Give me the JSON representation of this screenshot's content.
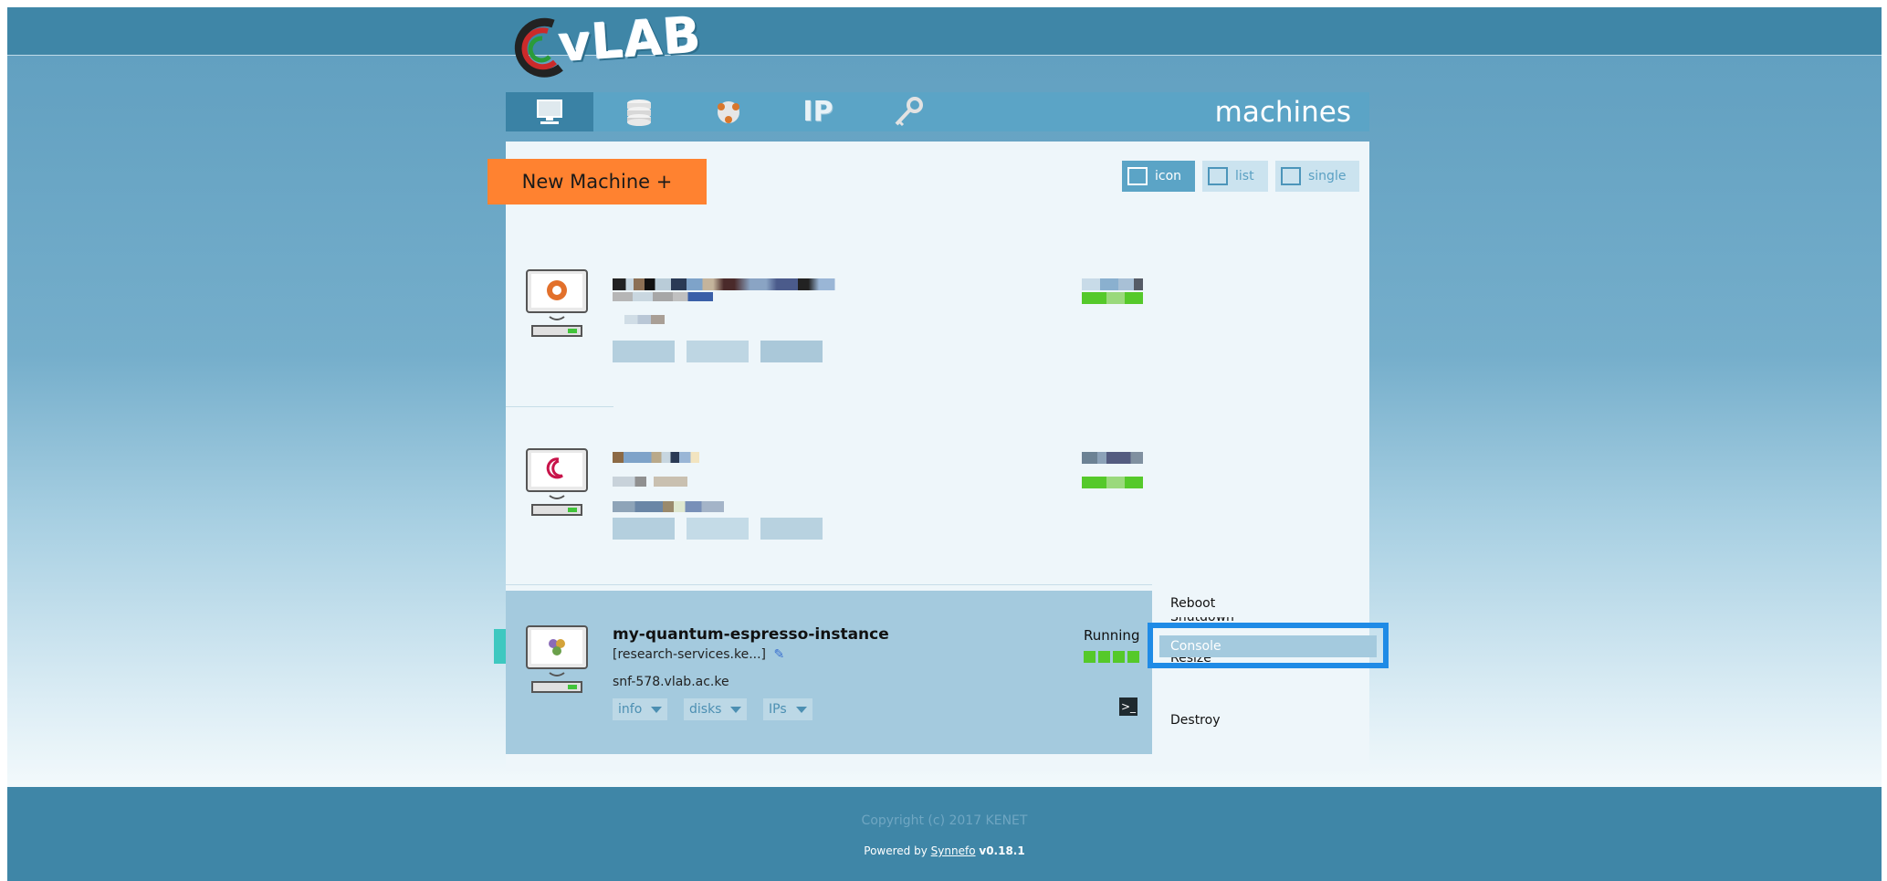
{
  "brand": {
    "logo_text": "vLAB"
  },
  "nav": {
    "title": "machines",
    "tabs": [
      {
        "icon": "monitor-icon",
        "active": true
      },
      {
        "icon": "database-icon",
        "active": false
      },
      {
        "icon": "network-icon",
        "active": false
      },
      {
        "icon": "ip-icon",
        "label": "IP",
        "active": false
      },
      {
        "icon": "key-icon",
        "active": false
      }
    ]
  },
  "toolbar": {
    "new_machine_label": "New Machine +",
    "views": [
      {
        "label": "icon",
        "active": true
      },
      {
        "label": "list",
        "active": false
      },
      {
        "label": "single",
        "active": false
      }
    ]
  },
  "machines": [
    {
      "os_icon": "ubuntu-icon",
      "redacted": true
    },
    {
      "os_icon": "debian-icon",
      "redacted": true
    },
    {
      "os_icon": "os-icon",
      "name": "my-quantum-espresso-instance",
      "flavor": "[research-services.ke...]",
      "hostname": "snf-578.vlab.ac.ke",
      "status": "Running",
      "status_level": 1.0,
      "tabs": [
        "info",
        "disks",
        "IPs"
      ],
      "actions": [
        "Reboot",
        "Shutdown",
        "Console",
        "Resize",
        "Destroy"
      ]
    }
  ],
  "footer": {
    "copyright": "Copyright (c) 2017 KENET",
    "powered_prefix": "Powered by",
    "powered_link": "Synnefo",
    "version": "v0.18.1"
  },
  "colors": {
    "accent": "#ff8230",
    "header": "#3f86a7",
    "nav": "#5ba4c6",
    "selected_row": "#a4cade",
    "highlight": "#1f8be6",
    "status_green": "#55c92a"
  }
}
